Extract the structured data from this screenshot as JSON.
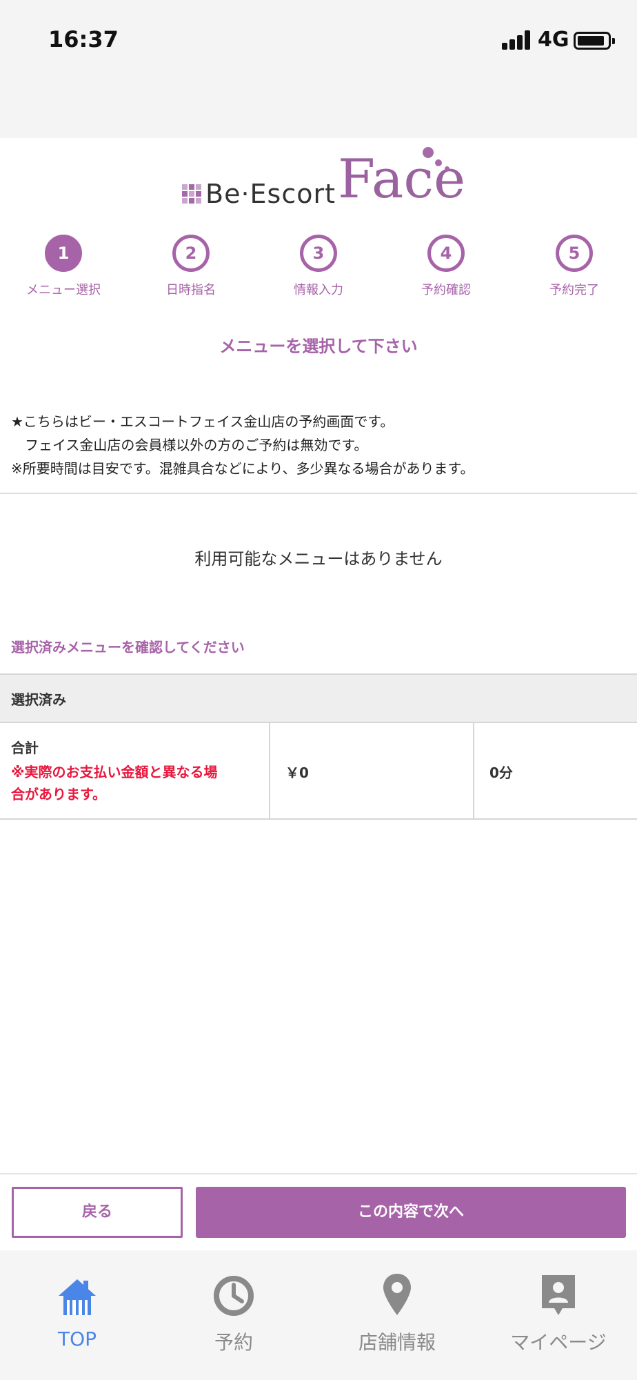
{
  "status_bar": {
    "time": "16:37",
    "network": "4G"
  },
  "logo": {
    "brand_prefix": "Be·Escort",
    "brand_main": "Face"
  },
  "steps": [
    {
      "number": "1",
      "label": "メニュー選択",
      "active": true
    },
    {
      "number": "2",
      "label": "日時指名",
      "active": false
    },
    {
      "number": "3",
      "label": "情報入力",
      "active": false
    },
    {
      "number": "4",
      "label": "予約確認",
      "active": false
    },
    {
      "number": "5",
      "label": "予約完了",
      "active": false
    }
  ],
  "heading": "メニューを選択して下さい",
  "notice": {
    "line1": "★こちらはビー・エスコートフェイス金山店の予約画面です。",
    "line2": "　フェイス金山店の会員様以外の方のご予約は無効です。",
    "line3": "※所要時間は目安です。混雑具合などにより、多少異なる場合があります。"
  },
  "empty_message": "利用可能なメニューはありません",
  "confirm_prompt": "選択済みメニューを確認してください",
  "selected_section": {
    "header": "選択済み",
    "total_label": "合計",
    "warning_line1": "※実際のお支払い金額と異なる場",
    "warning_line2": "合があります。",
    "price": "￥0",
    "duration": "0分"
  },
  "actions": {
    "back": "戻る",
    "next": "この内容で次へ"
  },
  "tabs": [
    {
      "label": "TOP",
      "icon": "home-icon",
      "active": true
    },
    {
      "label": "予約",
      "icon": "clock-icon",
      "active": false
    },
    {
      "label": "店舗情報",
      "icon": "map-pin-icon",
      "active": false
    },
    {
      "label": "マイページ",
      "icon": "profile-icon",
      "active": false
    }
  ],
  "colors": {
    "accent": "#a763a8",
    "warning": "#e8173c",
    "tab_active": "#4a86e8",
    "tab_inactive": "#8a8a8a"
  }
}
